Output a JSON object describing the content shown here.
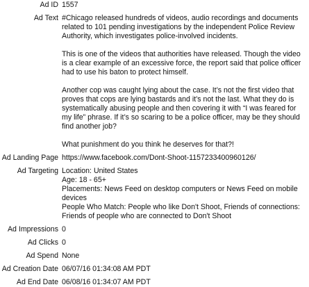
{
  "ad_id": {
    "label": "Ad ID",
    "value": "1557"
  },
  "ad_text": {
    "label": "Ad Text",
    "paragraphs": [
      "#Chicago released hundreds of videos, audio recordings and documents related to 101 pending investigations by the independent Police Review Authority, which investigates police-involved incidents.",
      "This is one of the videos that authorities have released. Though the video is a clear example of an excessive force, the report said that police officer had to use his baton to protect himself.",
      "Another cop was caught lying about the case. It’s not the first video that proves that cops are lying bastards and it’s not the last. What they do is systematically abusing people and then covering it with “I was feared for my life” phrase. If it’s so scaring to be a police officer, may be they should find another job?",
      "What punishment do you think he deserves for that?!"
    ]
  },
  "ad_landing_page": {
    "label": "Ad Landing Page",
    "value": "https://www.facebook.com/Dont-Shoot-1157233400960126/"
  },
  "ad_targeting": {
    "label": "Ad Targeting",
    "lines": [
      "Location: United States",
      "Age: 18 - 65+",
      "Placements: News Feed on desktop computers or News Feed on mobile devices",
      "People Who Match: People who like Don't Shoot, Friends of connections: Friends of people who are connected to Don't Shoot"
    ]
  },
  "ad_impressions": {
    "label": "Ad Impressions",
    "value": "0"
  },
  "ad_clicks": {
    "label": "Ad Clicks",
    "value": "0"
  },
  "ad_spend": {
    "label": "Ad Spend",
    "value": "None"
  },
  "ad_creation_date": {
    "label": "Ad Creation Date",
    "value": "06/07/16 01:34:08 AM PDT"
  },
  "ad_end_date": {
    "label": "Ad End Date",
    "value": "06/08/16 01:34:07 AM PDT"
  }
}
